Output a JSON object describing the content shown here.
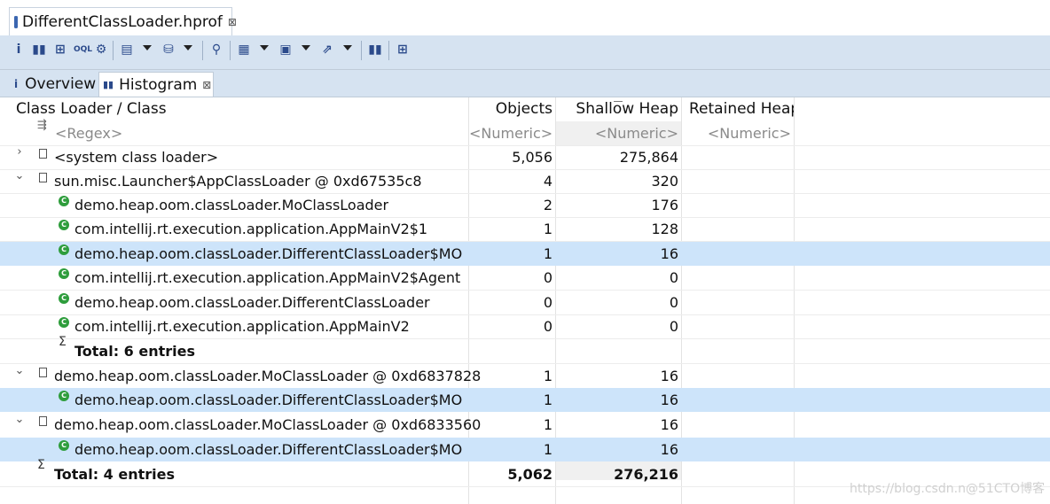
{
  "editor": {
    "title": "DifferentClassLoader.hprof",
    "close_glyph": "⊠"
  },
  "subtabs": [
    {
      "label": "Overview",
      "icon": "info-icon"
    },
    {
      "label": "Histogram",
      "icon": "histogram-icon",
      "close_glyph": "⊠"
    }
  ],
  "columns": {
    "name": "Class Loader / Class",
    "objects": "Objects",
    "shallow": "Shallow Heap",
    "retained": "Retained Heap"
  },
  "filters": {
    "name": "<Regex>",
    "objects": "<Numeric>",
    "shallow": "<Numeric>",
    "retained": "<Numeric>"
  },
  "rows": [
    {
      "name": "<system class loader>",
      "objects": "5,056",
      "shallow": "275,864",
      "retained": ""
    },
    {
      "name": "sun.misc.Launcher$AppClassLoader @ 0xd67535c8",
      "objects": "4",
      "shallow": "320",
      "retained": ""
    },
    {
      "name": "demo.heap.oom.classLoader.MoClassLoader",
      "objects": "2",
      "shallow": "176",
      "retained": ""
    },
    {
      "name": "com.intellij.rt.execution.application.AppMainV2$1",
      "objects": "1",
      "shallow": "128",
      "retained": ""
    },
    {
      "name": "demo.heap.oom.classLoader.DifferentClassLoader$MO",
      "objects": "1",
      "shallow": "16",
      "retained": ""
    },
    {
      "name": "com.intellij.rt.execution.application.AppMainV2$Agent",
      "objects": "0",
      "shallow": "0",
      "retained": ""
    },
    {
      "name": "demo.heap.oom.classLoader.DifferentClassLoader",
      "objects": "0",
      "shallow": "0",
      "retained": ""
    },
    {
      "name": "com.intellij.rt.execution.application.AppMainV2",
      "objects": "0",
      "shallow": "0",
      "retained": ""
    },
    {
      "name": "Total: 6 entries",
      "objects": "",
      "shallow": "",
      "retained": ""
    },
    {
      "name": "demo.heap.oom.classLoader.MoClassLoader @ 0xd6837828",
      "objects": "1",
      "shallow": "16",
      "retained": ""
    },
    {
      "name": "demo.heap.oom.classLoader.DifferentClassLoader$MO",
      "objects": "1",
      "shallow": "16",
      "retained": ""
    },
    {
      "name": "demo.heap.oom.classLoader.MoClassLoader @ 0xd6833560",
      "objects": "1",
      "shallow": "16",
      "retained": ""
    },
    {
      "name": "demo.heap.oom.classLoader.DifferentClassLoader$MO",
      "objects": "1",
      "shallow": "16",
      "retained": ""
    },
    {
      "name": "Total: 4 entries",
      "objects": "5,062",
      "shallow": "276,216",
      "retained": ""
    }
  ],
  "watermark": "https://blog.csdn.n@51CTO博客",
  "colors": {
    "selection": "#cde4fa",
    "toolbar": "#d6e3f1",
    "class_icon": "#2e9d3c"
  }
}
